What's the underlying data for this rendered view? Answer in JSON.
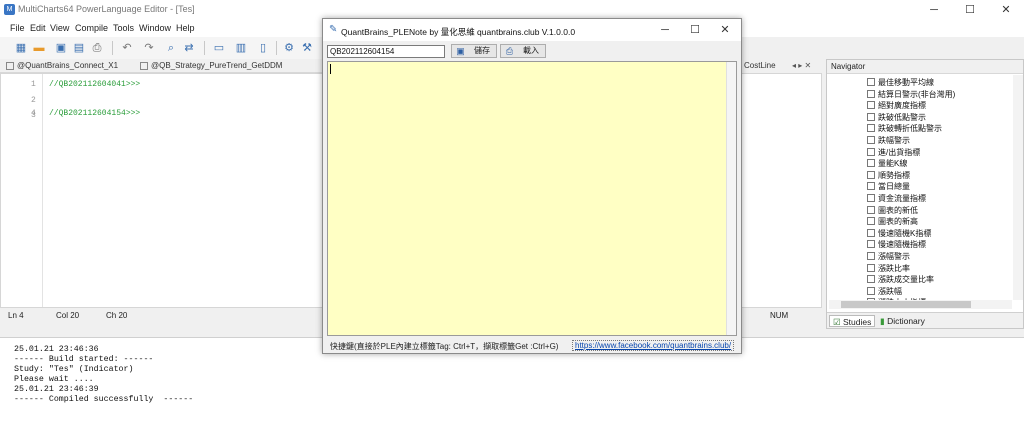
{
  "app": {
    "title": "MultiCharts64 PowerLanguage Editor - [Tes]",
    "window_controls": {
      "minimize": "─",
      "maximize": "☐",
      "close": "✕"
    }
  },
  "menu": [
    "File",
    "Edit",
    "View",
    "Compile",
    "Tools",
    "Window",
    "Help"
  ],
  "toolbar_icons": [
    "new-icon",
    "open-folder-icon",
    "save-icon",
    "save-all-icon",
    "print-icon",
    "undo-icon",
    "redo-icon",
    "find-icon",
    "replace-icon",
    "window-1-icon",
    "window-2-icon",
    "window-3-icon",
    "compile-icon",
    "build-icon"
  ],
  "tabs": [
    {
      "label": "@QuantBrains_Connect_X1"
    },
    {
      "label": "@QB_Strategy_PureTrend_GetDDM"
    },
    {
      "label": "CostLine"
    }
  ],
  "editor": {
    "lines": [
      {
        "num": "1",
        "text": "//QB202112604041>>>"
      },
      {
        "num": "2",
        "text": ""
      },
      {
        "num": "3",
        "text": ""
      },
      {
        "num": "4",
        "text": "//QB202112604154>>>"
      }
    ]
  },
  "statusbar": {
    "ln": "Ln 4",
    "col": "Col 20",
    "ch": "Ch 20",
    "num": "NUM"
  },
  "output": {
    "text": "25.01.21 23:46:36\n------ Build started: ------\nStudy: \"Tes\" (Indicator)\nPlease wait ....\n25.01.21 23:46:39\n------ Compiled successfully  ------"
  },
  "navigator": {
    "title": "Navigator",
    "items": [
      "最佳移動平均線",
      "結算日警示(非台灣用)",
      "絕對廣度指標",
      "跌破低點警示",
      "跌破轉折低點警示",
      "跌幅警示",
      "進/出貨指標",
      "量能K線",
      "順勢指標",
      "當日總量",
      "資金流量指標",
      "圖表的新低",
      "圖表的新高",
      "慢速隨機K指標",
      "慢速隨機指標",
      "漲幅警示",
      "漲跌比率",
      "漲跌成交量比率",
      "漲跌幅",
      "漲跌大小指標"
    ],
    "tabs": {
      "studies": "Studies",
      "dictionary": "Dictionary"
    }
  },
  "dialog": {
    "title": "QuantBrains_PLENote  by 量化思維 quantbrains.club  V.1.0.0.0",
    "controls": {
      "minimize": "─",
      "maximize": "☐",
      "close": "✕"
    },
    "tag_value": "QB202112604154",
    "save_label": "儲存",
    "load_label": "載入",
    "note_text": "",
    "hint": "快捷鍵(直接於PLE內建立標籤Tag: Ctrl+T，擷取標籤Get :Ctrl+G)",
    "link": "https://www.facebook.com/quantbrains.club/",
    "note_bg": "#ffffc4"
  }
}
